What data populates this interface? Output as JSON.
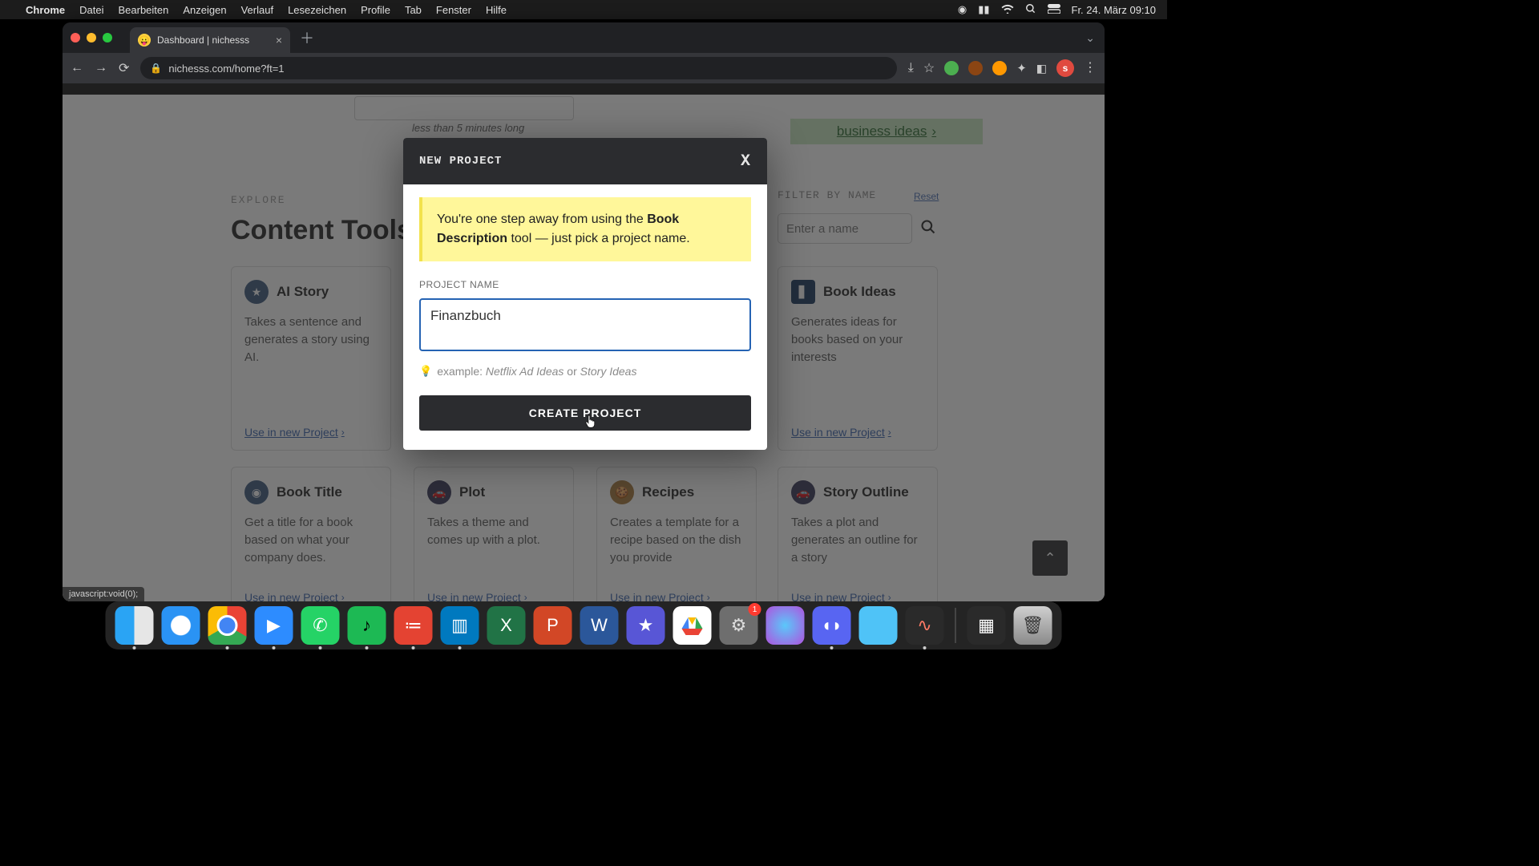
{
  "mac": {
    "app": "Chrome",
    "menu": [
      "Datei",
      "Bearbeiten",
      "Anzeigen",
      "Verlauf",
      "Lesezeichen",
      "Profile",
      "Tab",
      "Fenster",
      "Hilfe"
    ],
    "clock": "Fr. 24. März 09:10"
  },
  "chrome": {
    "tab_title": "Dashboard | nichesss",
    "url": "nichesss.com/home?ft=1",
    "avatar_letter": "s",
    "status_link": "javascript:void(0);"
  },
  "page": {
    "hint_italic": "less than 5 minutes long",
    "business_link": "business ideas",
    "explore_label": "EXPLORE",
    "heading": "Content Tools",
    "filter_label": "FILTER BY NAME",
    "filter_reset": "Reset",
    "filter_placeholder": "Enter a name",
    "use_in_project": "Use in new Project"
  },
  "cards": {
    "r1c1": {
      "title": "AI Story",
      "desc": "Takes a sentence and generates a story using AI."
    },
    "r1c4": {
      "title": "Book Ideas",
      "desc": "Generates ideas for books based on your interests"
    },
    "r2c1": {
      "title": "Book Title",
      "desc": "Get a title for a book based on what your company does."
    },
    "r2c2": {
      "title": "Plot",
      "desc": "Takes a theme and comes up with a plot."
    },
    "r2c3": {
      "title": "Recipes",
      "desc": "Creates a template for a recipe based on the dish you provide"
    },
    "r2c4": {
      "title": "Story Outline",
      "desc": "Takes a plot and generates an outline for a story"
    }
  },
  "modal": {
    "title": "NEW PROJECT",
    "banner_pre": "You're one step away from using the ",
    "banner_bold": "Book Description",
    "banner_post": " tool — just pick a project name.",
    "field_label": "PROJECT NAME",
    "input_value": "Finanzbuch",
    "example_label": "example: ",
    "example_a": "Netflix Ad Ideas",
    "example_or": " or ",
    "example_b": "Story Ideas",
    "submit": "CREATE PROJECT"
  },
  "dock": {
    "settings_badge": "1"
  }
}
